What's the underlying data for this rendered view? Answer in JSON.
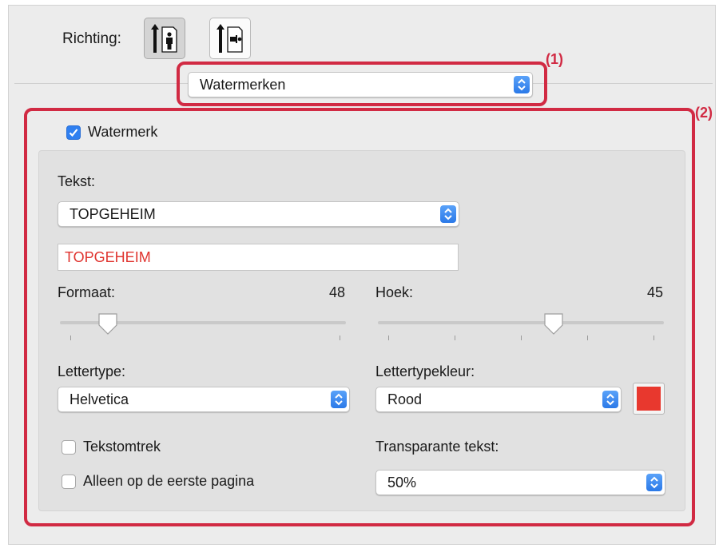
{
  "orientation": {
    "label": "Richting:",
    "options": [
      {
        "name": "portrait",
        "icon": "portrait-orientation-icon",
        "selected": true
      },
      {
        "name": "landscape",
        "icon": "landscape-orientation-icon",
        "selected": false
      }
    ]
  },
  "panel_select": {
    "value": "Watermerken"
  },
  "callouts": {
    "one": "(1)",
    "two": "(2)"
  },
  "watermark": {
    "enable_label": "Watermerk",
    "enabled": true,
    "text_label": "Tekst:",
    "text_preset": "TOPGEHEIM",
    "text_value": "TOPGEHEIM",
    "size_label": "Formaat:",
    "size_value": "48",
    "size_slider": {
      "min": 0,
      "max": 250,
      "value": 48
    },
    "angle_label": "Hoek:",
    "angle_value": "45",
    "angle_slider": {
      "min": -90,
      "max": 90,
      "value": 45
    },
    "font_label": "Lettertype:",
    "font_value": "Helvetica",
    "color_label": "Lettertypekleur:",
    "color_value": "Rood",
    "color_swatch": "#e8382e",
    "outline_label": "Tekstomtrek",
    "outline_checked": false,
    "first_page_label": "Alleen op de eerste pagina",
    "first_page_checked": false,
    "transparency_label": "Transparante tekst:",
    "transparency_value": "50%"
  },
  "colors": {
    "callout_red": "#d12a43",
    "accent_blue": "#2f7ff0",
    "text_red": "#e0342f"
  }
}
